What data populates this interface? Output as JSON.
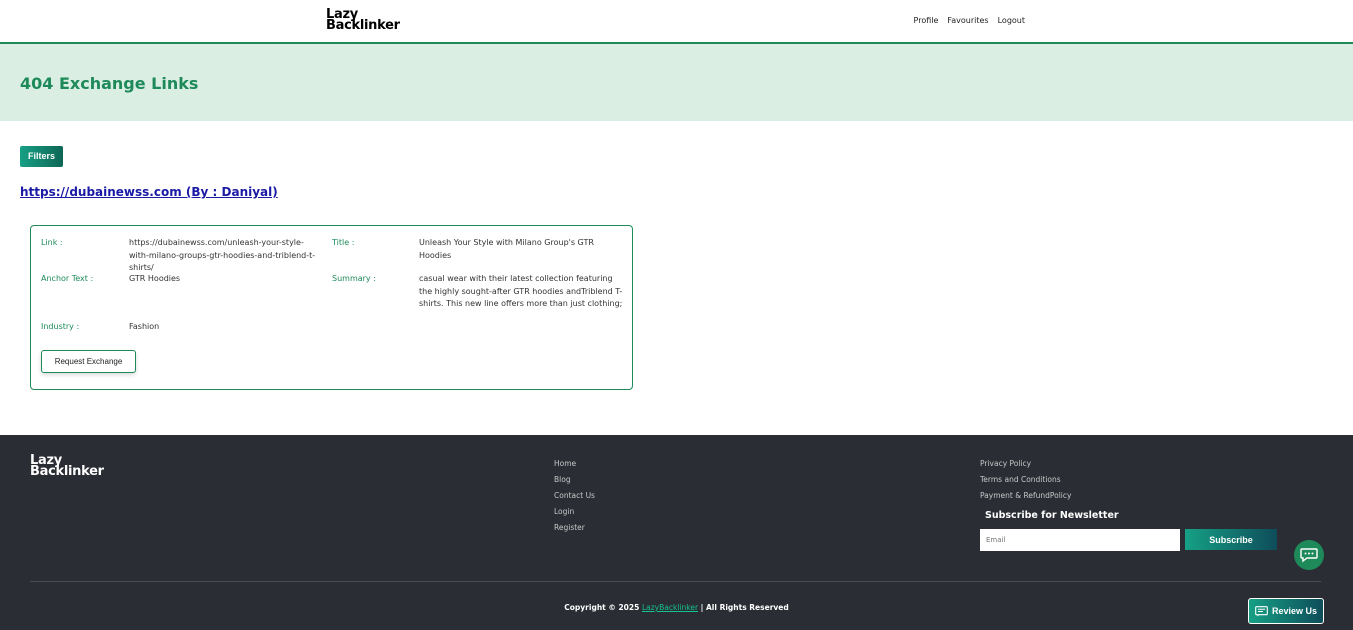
{
  "header": {
    "logo_line1": "Lazy",
    "logo_line2": "Backlinker",
    "nav": [
      "Profile",
      "Favourites",
      "Logout"
    ]
  },
  "hero": {
    "title": "404 Exchange Links"
  },
  "filters_label": "Filters",
  "site_link": "https://dubainewss.com (By : Daniyal)",
  "card": {
    "link_label": "Link :",
    "link_value": "https://dubainewss.com/unleash-your-style-with-milano-groups-gtr-hoodies-and-triblend-t-shirts/",
    "title_label": "Title :",
    "title_value": "Unleash Your Style with Milano Group's GTR Hoodies",
    "anchor_label": "Anchor Text :",
    "anchor_value": "GTR Hoodies",
    "summary_label": "Summary :",
    "summary_value": "casual wear with their latest collection featuring the highly sought-after GTR hoodies andTriblend T-shirts. This new line offers more than just clothing;",
    "industry_label": "Industry :",
    "industry_value": "Fashion",
    "request_button": "Request Exchange"
  },
  "footer": {
    "logo_line1": "Lazy",
    "logo_line2": "Backlinker",
    "links_col1": [
      "Home",
      "Blog",
      "Contact Us",
      "Login",
      "Register"
    ],
    "links_col2": [
      "Privacy Policy",
      "Terms and Conditions",
      "Payment & RefundPolicy"
    ],
    "newsletter_title": "Subscribe for Newsletter",
    "email_placeholder": "Email",
    "subscribe_label": "Subscribe",
    "copyright_prefix": "Copyright © 2025",
    "copyright_link": "LazyBacklinker",
    "copyright_suffix": "| All Rights Reserved",
    "review_label": "Review Us"
  },
  "colors": {
    "accent": "#1e8a5a",
    "hero_bg": "#daeee4",
    "footer_bg": "#2a2d34"
  }
}
